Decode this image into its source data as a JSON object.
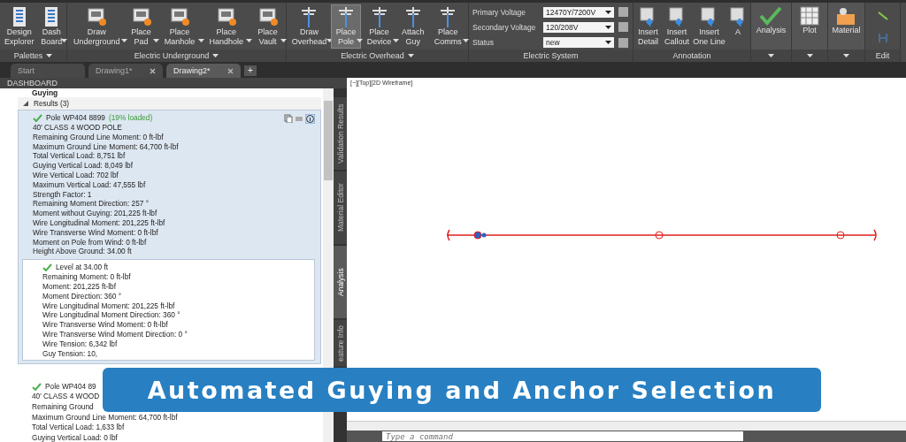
{
  "ribbon": {
    "panels": [
      {
        "title": "Palettes",
        "menu": true,
        "kind": "buttons",
        "buttons": [
          {
            "label": "Design Explorer",
            "selected": false,
            "dropdown": false
          },
          {
            "label": "Dash Board",
            "selected": false,
            "dropdown": true
          }
        ]
      },
      {
        "title": "Electric Underground",
        "menu": true,
        "kind": "buttons",
        "buttons": [
          {
            "label": "Draw Underground",
            "selected": false,
            "dropdown": true
          },
          {
            "label": "Place Pad",
            "selected": false,
            "dropdown": true
          },
          {
            "label": "Place Manhole",
            "selected": false,
            "dropdown": true
          },
          {
            "label": "Place Handhole",
            "selected": false,
            "dropdown": true
          },
          {
            "label": "Place Vault",
            "selected": false,
            "dropdown": true
          }
        ]
      },
      {
        "title": "Electric Overhead",
        "menu": true,
        "kind": "buttons",
        "buttons": [
          {
            "label": "Draw Overhead",
            "selected": false,
            "dropdown": true
          },
          {
            "label": "Place Pole",
            "selected": true,
            "dropdown": true
          },
          {
            "label": "Place Device",
            "selected": false,
            "dropdown": true
          },
          {
            "label": "Attach Guy",
            "selected": false,
            "dropdown": false
          },
          {
            "label": "Place Comms",
            "selected": false,
            "dropdown": true
          }
        ]
      },
      {
        "title": "Electric System",
        "menu": false,
        "kind": "fields",
        "fields": [
          {
            "label": "Primary Voltage",
            "value": "12470Y/7200V"
          },
          {
            "label": "Secondary Voltage",
            "value": "120/208V"
          },
          {
            "label": "Status",
            "value": "new"
          }
        ]
      },
      {
        "title": "Annotation",
        "menu": false,
        "kind": "buttons",
        "buttons": [
          {
            "label": "Insert Detail",
            "selected": false,
            "dropdown": false
          },
          {
            "label": "Insert Callout",
            "selected": false,
            "dropdown": false
          },
          {
            "label": "Insert One Line",
            "selected": false,
            "dropdown": false
          },
          {
            "label": "A",
            "selected": false,
            "dropdown": false
          }
        ]
      },
      {
        "menu": true,
        "kind": "big",
        "buttons": [
          {
            "label": "Analysis",
            "selected": false,
            "dropdown": false
          }
        ]
      },
      {
        "menu": true,
        "kind": "big",
        "buttons": [
          {
            "label": "Plot",
            "selected": false,
            "dropdown": false
          }
        ]
      },
      {
        "menu": true,
        "kind": "big",
        "buttons": [
          {
            "label": "Material",
            "selected": false,
            "dropdown": false
          }
        ]
      },
      {
        "title": "Edit",
        "menu": false,
        "kind": "small"
      }
    ]
  },
  "tabs": [
    {
      "label": "Start",
      "selected": false,
      "closable": false
    },
    {
      "label": "Drawing1*",
      "selected": false,
      "closable": true
    },
    {
      "label": "Drawing2*",
      "selected": true,
      "closable": true
    }
  ],
  "new_tab_button": "+",
  "dashboard": {
    "title": "DASHBOARD",
    "section": "Guying",
    "results": {
      "label": "Results (3)",
      "expanded": true,
      "items": [
        {
          "title": "Pole WP404 8899",
          "status": "(19% loaded)",
          "ok": true,
          "lines": [
            "40' CLASS 4 WOOD POLE",
            "Remaining Ground Line Moment: 0 ft-lbf",
            "Maximum Ground Line Moment: 64,700 ft-lbf",
            "Total Vertical Load: 8,751 lbf",
            "Guying Vertical Load: 8,049 lbf",
            "Wire Vertical Load: 702 lbf",
            "Maximum Vertical Load: 47,555 lbf",
            "Strength Factor: 1",
            "Remaining Moment Direction: 257 °",
            "Moment without Guying: 201,225 ft-lbf",
            "Wire Longitudinal Moment: 201,225 ft-lbf",
            "Wire Transverse Wind Moment: 0 ft-lbf",
            "Moment on Pole from Wind: 0 ft-lbf",
            "Height Above Ground: 34.00 ft"
          ],
          "levels": [
            {
              "title": "Level at 34.00 ft",
              "ok": true,
              "lines": [
                "Remaining Moment: 0 ft-lbf",
                "Moment: 201,225 ft-lbf",
                "Moment Direction: 360 °",
                "Wire Longitudinal Moment: 201,225 ft-lbf",
                "Wire Longitudinal Moment Direction: 360 °",
                "Wire Transverse Wind Moment: 0 ft-lbf",
                "Wire Transverse Wind Moment Direction: 0 °",
                "Wire Tension: 6,342 lbf",
                "Guy Tension: 10,"
              ]
            }
          ]
        },
        {
          "title": "Pole WP404 89",
          "ok": true,
          "lines": [
            "40' CLASS 4 WOOD",
            "Remaining Ground",
            "Maximum Ground Line Moment: 64,700 ft-lbf",
            "Total Vertical Load: 1,633 lbf",
            "Guying Vertical Load: 0 lbf"
          ]
        }
      ]
    }
  },
  "side_tabs": [
    {
      "label": "Validation Results",
      "selected": false
    },
    {
      "label": "Material Editor",
      "selected": false
    },
    {
      "label": "Analysis",
      "selected": true
    },
    {
      "label": "eature Info",
      "selected": false
    }
  ],
  "viewport": {
    "label": "[−][Top][2D Wireframe]"
  },
  "command_line": {
    "placeholder": "Type a command"
  },
  "banner": {
    "text": "Automated Guying and Anchor Selection"
  }
}
